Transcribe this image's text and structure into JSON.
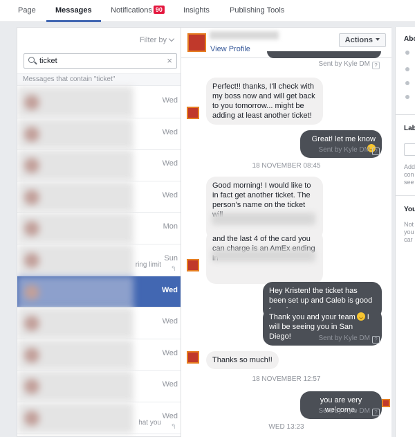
{
  "tabs": [
    {
      "label": "Page"
    },
    {
      "label": "Messages"
    },
    {
      "label": "Notifications",
      "badge": "90"
    },
    {
      "label": "Insights"
    },
    {
      "label": "Publishing Tools"
    }
  ],
  "inbox": {
    "filter_label": "Filter by",
    "search_value": "ticket",
    "clear_glyph": "×",
    "contain_label": "Messages that contain \"ticket\"",
    "threads": [
      {
        "date": "Wed",
        "snippet": ""
      },
      {
        "date": "Wed",
        "snippet": ""
      },
      {
        "date": "Wed",
        "snippet": ""
      },
      {
        "date": "Wed",
        "snippet": ""
      },
      {
        "date": "Mon",
        "snippet": ""
      },
      {
        "date": "Sun",
        "snippet": "ring limit"
      },
      {
        "date": "Wed",
        "snippet": ""
      },
      {
        "date": "Wed",
        "snippet": ""
      },
      {
        "date": "Wed",
        "snippet": ""
      },
      {
        "date": "Wed",
        "snippet": ""
      },
      {
        "date": "Wed",
        "snippet": "hat you"
      }
    ]
  },
  "conversation": {
    "view_profile": "View Profile",
    "actions_label": "Actions",
    "sent_by_1": "Sent by Kyle DM",
    "msg_in_1": "Perfect!! thanks, I'll check with my boss now and will get back to you tomorrow... might be adding at least another ticket!",
    "msg_out_1": "Great! let me know",
    "sent_by_2": "Sent by Kyle DM",
    "ts_1": "18 NOVEMBER 08:45",
    "msg_in_2a": "Good morning! I would like to in fact get another ticket. The person's name on the ticket will",
    "msg_in_2b": "and the last 4 of the card you can charge is an AmEx ending in",
    "msg_out_2": "Hey Kristen! the ticket has been set up and Caleb is good to go!",
    "msg_out_3a": "Thank you and your team",
    "msg_out_3b": " I will be seeing you in San Diego!",
    "sent_by_3": "Sent by Kyle DM",
    "msg_in_3": "Thanks so much!!",
    "ts_2": "18 NOVEMBER 12:57",
    "msg_out_4": "you are very welcome.",
    "sent_by_4": "Sent by Kyle DM",
    "ts_3": "WED 13:23"
  },
  "sidebar_right": {
    "about": "Abo",
    "labels": "Lab",
    "labels_text": [
      "Add",
      "con",
      "see"
    ],
    "you": "You",
    "you_text": [
      "Not",
      "you",
      "car"
    ]
  }
}
